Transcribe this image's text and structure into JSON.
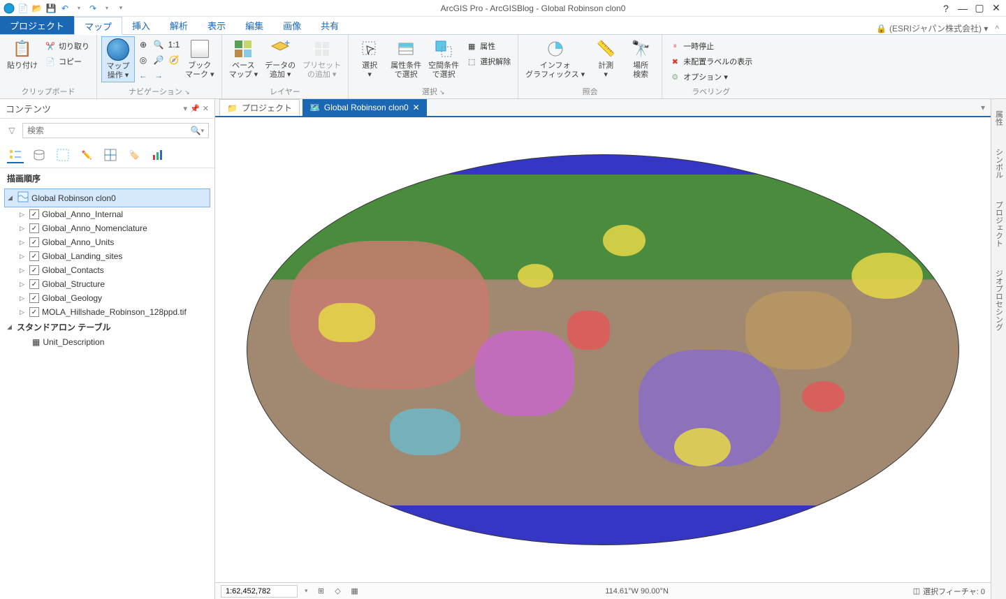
{
  "title": "ArcGIS Pro - ArcGISBlog - Global Robinson clon0",
  "signin": {
    "lock_icon": "🔒",
    "text": "(ESRIジャパン株式会社) ▾"
  },
  "tabs": {
    "file": "プロジェクト",
    "items": [
      "マップ",
      "挿入",
      "解析",
      "表示",
      "編集",
      "画像",
      "共有"
    ],
    "active_index": 0
  },
  "ribbon": {
    "clipboard": {
      "paste": "貼り付け",
      "cut": "切り取り",
      "copy": "コピー",
      "label": "クリップボード"
    },
    "navigation": {
      "explore": "マップ\n操作 ▾",
      "bookmarks": "ブック\nマーク ▾",
      "label": "ナビゲーション"
    },
    "layer": {
      "basemap": "ベース\nマップ ▾",
      "adddata": "データの\n追加 ▾",
      "addpreset": "プリセット\nの追加 ▾",
      "label": "レイヤー"
    },
    "selection": {
      "select": "選択\n▾",
      "byattr": "属性条件\nで選択",
      "byloc": "空間条件\nで選択",
      "attributes": "属性",
      "clearsel": "選択解除",
      "label": "選択"
    },
    "inquiry": {
      "infographics": "インフォ\nグラフィックス ▾",
      "measure": "計測\n▾",
      "locate": "場所\n検索",
      "label": "照会"
    },
    "labeling": {
      "pause": "一時停止",
      "viewunplaced": "未配置ラベルの表示",
      "options": "オプション ▾",
      "label": "ラベリング"
    }
  },
  "contents": {
    "title": "コンテンツ",
    "search_placeholder": "検索",
    "draw_order": "描画順序",
    "map_name": "Global Robinson clon0",
    "layers": [
      "Global_Anno_Internal",
      "Global_Anno_Nomenclature",
      "Global_Anno_Units",
      "Global_Landing_sites",
      "Global_Contacts",
      "Global_Structure",
      "Global_Geology",
      "MOLA_Hillshade_Robinson_128ppd.tif"
    ],
    "standalone_header": "スタンドアロン テーブル",
    "standalone_table": "Unit_Description"
  },
  "viewtabs": {
    "project": "プロジェクト",
    "map": "Global Robinson clon0"
  },
  "statusbar": {
    "scale": "1:62,452,782",
    "coords": "114.61°W 90.00°N",
    "selected": "選択フィーチャ: 0"
  },
  "rightdock": [
    "属性",
    "シンボル",
    "プロジェクト",
    "ジオプロセシング"
  ]
}
